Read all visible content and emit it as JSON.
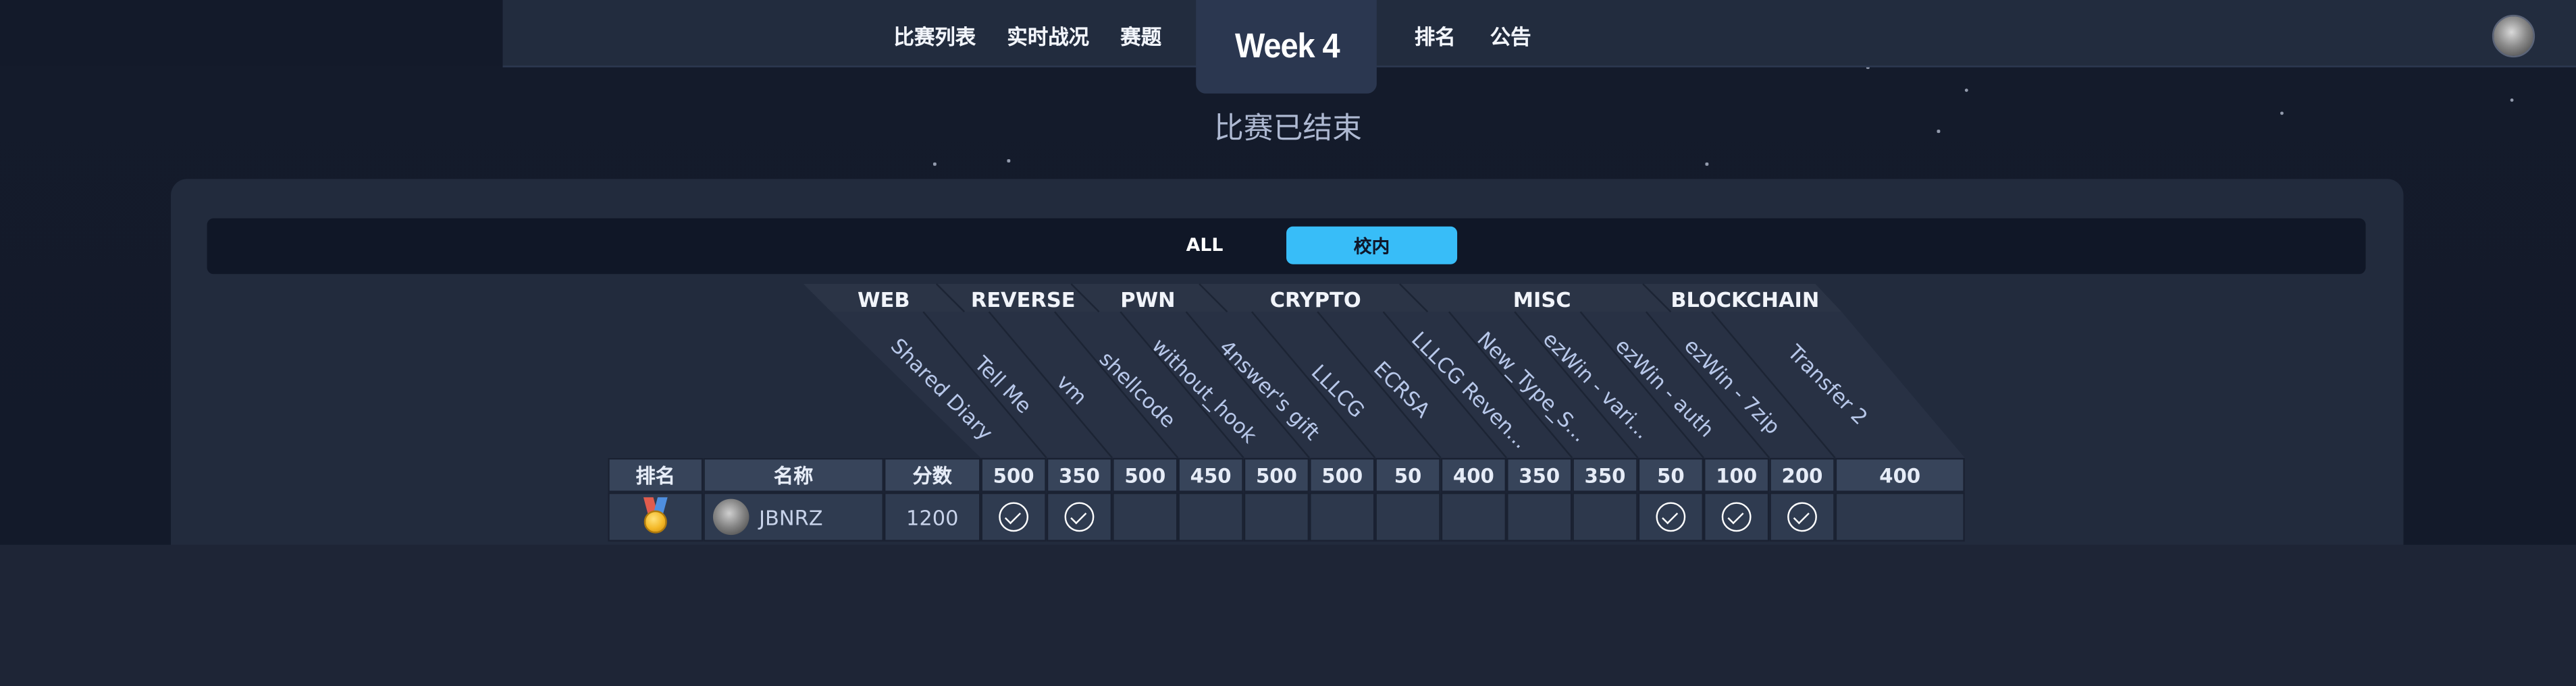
{
  "nav": {
    "items": [
      "比赛列表",
      "实时战况",
      "赛题",
      "排名",
      "公告"
    ],
    "week": "Week 4"
  },
  "status": "比赛已结束",
  "filters": {
    "all": "ALL",
    "school": "校内",
    "active": "校内"
  },
  "categories": [
    "WEB",
    "REVERSE",
    "PWN",
    "CRYPTO",
    "MISC",
    "BLOCKCHAIN"
  ],
  "challenges": [
    {
      "name": "Shared Diary",
      "category": "WEB",
      "score": "500"
    },
    {
      "name": "Tell Me",
      "category": "WEB",
      "score": "350"
    },
    {
      "name": "vm",
      "category": "REVERSE",
      "score": "500"
    },
    {
      "name": "shellcode",
      "category": "PWN",
      "score": "450"
    },
    {
      "name": "without_hook",
      "category": "PWN",
      "score": "500"
    },
    {
      "name": "4nswer's gift",
      "category": "CRYPTO",
      "score": "500"
    },
    {
      "name": "LLLCG",
      "category": "CRYPTO",
      "score": "50"
    },
    {
      "name": "ECRSA",
      "category": "CRYPTO",
      "score": "400"
    },
    {
      "name": "LLLCG Reven...",
      "category": "CRYPTO",
      "score": "350"
    },
    {
      "name": "New_Type_S...",
      "category": "MISC",
      "score": "350"
    },
    {
      "name": "ezWin - vari...",
      "category": "MISC",
      "score": "50"
    },
    {
      "name": "ezWin - auth",
      "category": "MISC",
      "score": "100"
    },
    {
      "name": "ezWin - 7zip",
      "category": "MISC",
      "score": "200"
    },
    {
      "name": "Transfer 2",
      "category": "BLOCKCHAIN",
      "score": "400"
    }
  ],
  "table": {
    "headers": {
      "rank": "排名",
      "name": "名称",
      "score": "分数"
    },
    "rows": [
      {
        "rank_icon": "gold-medal-icon",
        "name": "JBNRZ",
        "score": "1200",
        "solved": [
          true,
          true,
          false,
          false,
          false,
          false,
          false,
          false,
          false,
          false,
          true,
          true,
          true,
          false
        ]
      }
    ]
  },
  "colors": {
    "accent": "#38bdf8",
    "navbar": "#222c3e",
    "panel": "#222b3d"
  }
}
